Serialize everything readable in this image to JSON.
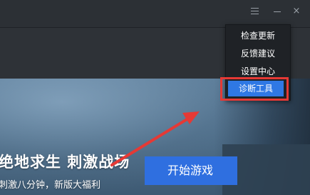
{
  "window": {
    "controls": {
      "menu_icon": "hamburger-menu-icon",
      "minimize_icon": "minimize-icon",
      "close_icon": "close-icon",
      "close_glyph": "×"
    }
  },
  "banner": {
    "headline": "绝地求生 刺激战场",
    "subline": "刺激八分钟，新版大福利",
    "start_button": "开始游戏"
  },
  "dropdown_menu": {
    "items": [
      {
        "label": "检查更新"
      },
      {
        "label": "反馈建议"
      },
      {
        "label": "设置中心"
      },
      {
        "label": "诊断工具"
      }
    ],
    "highlighted_index": 3
  },
  "annotation": {
    "arrow_color": "#e53935",
    "highlight_color": "#e53935"
  }
}
